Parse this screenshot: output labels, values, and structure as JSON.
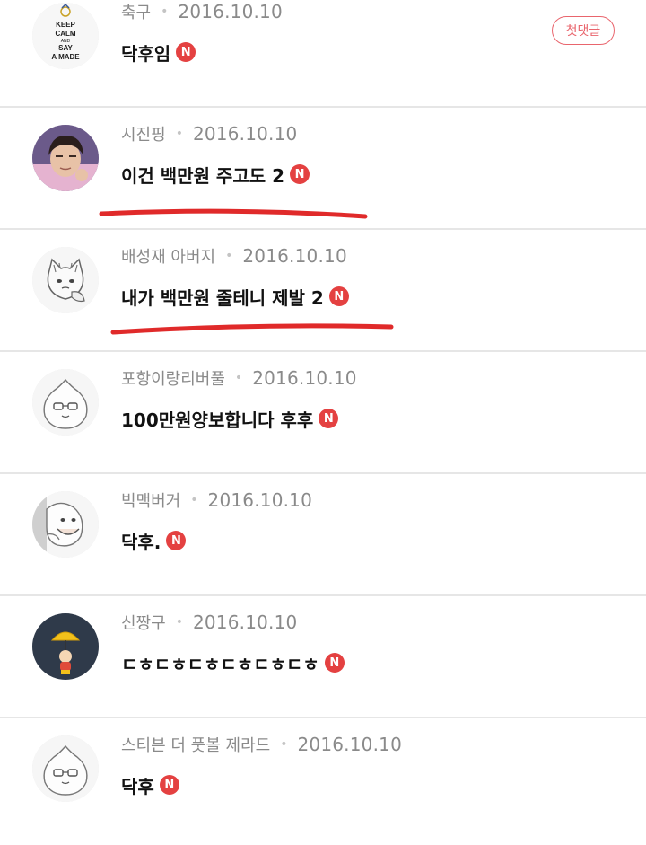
{
  "comments": [
    {
      "nickname": "축구",
      "date": "2016.10.10",
      "text": "닥후임",
      "new_badge": "N",
      "badge": "첫댓글",
      "avatar_text": [
        "KEEP",
        "CALM",
        "AND",
        "SAY",
        "A MADE"
      ]
    },
    {
      "nickname": "시진핑",
      "date": "2016.10.10",
      "text": "이건 백만원 주고도 2",
      "new_badge": "N",
      "underlined": true
    },
    {
      "nickname": "배성재 아버지",
      "date": "2016.10.10",
      "text": "내가 백만원 줄테니 제발 2",
      "new_badge": "N",
      "underlined": true
    },
    {
      "nickname": "포항이랑리버풀",
      "date": "2016.10.10",
      "text": "100만원양보합니다 후후",
      "new_badge": "N"
    },
    {
      "nickname": "빅맥버거",
      "date": "2016.10.10",
      "text": "닥후.",
      "new_badge": "N"
    },
    {
      "nickname": "신짱구",
      "date": "2016.10.10",
      "text": "ㄷㅎㄷㅎㄷㅎㄷㅎㄷㅎㄷㅎ",
      "new_badge": "N"
    },
    {
      "nickname": "스티븐 더 풋볼 제라드",
      "date": "2016.10.10",
      "text": "닥후",
      "new_badge": "N"
    }
  ],
  "dot_separator": "•",
  "colors": {
    "new_badge": "#e44141",
    "first_badge": "#e9656d",
    "underline": "#e02a2a",
    "meta_text": "#8a8a8a"
  }
}
